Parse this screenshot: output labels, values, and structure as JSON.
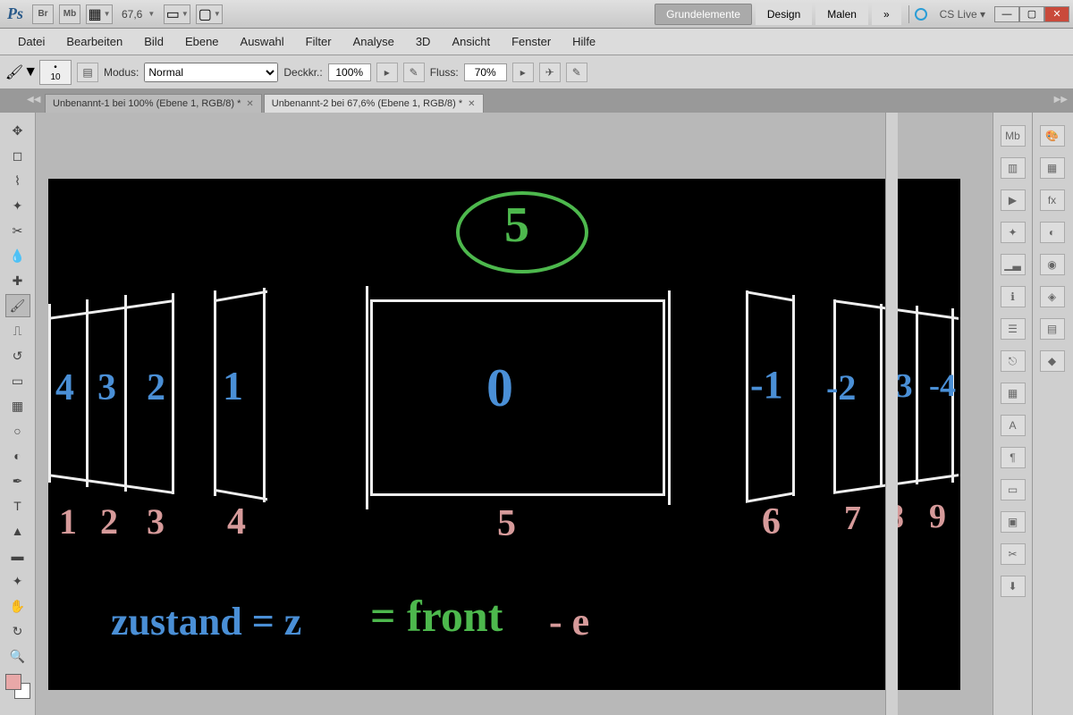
{
  "titlebar": {
    "app": "Ps",
    "br": "Br",
    "mb": "Mb",
    "zoom": "67,6",
    "workspaces": [
      "Grundelemente",
      "Design",
      "Malen"
    ],
    "active_workspace": 0,
    "more": "»",
    "cslive": "CS Live ▾"
  },
  "menu": [
    "Datei",
    "Bearbeiten",
    "Bild",
    "Ebene",
    "Auswahl",
    "Filter",
    "Analyse",
    "3D",
    "Ansicht",
    "Fenster",
    "Hilfe"
  ],
  "options": {
    "brush_size": "10",
    "modus_label": "Modus:",
    "modus_value": "Normal",
    "deckkraft_label": "Deckkr.:",
    "deckkraft_value": "100%",
    "fluss_label": "Fluss:",
    "fluss_value": "70%"
  },
  "doc_tabs": [
    "Unbenannt-1 bei 100% (Ebene 1, RGB/8) *",
    "Unbenannt-2 bei 67,6% (Ebene 1, RGB/8) *"
  ],
  "active_tab": 1,
  "canvas": {
    "circle_num": "5",
    "center_num": "0",
    "left_blue": [
      "4",
      "3",
      "2",
      "1"
    ],
    "right_blue": [
      "-1",
      "-2",
      "-3",
      "-4"
    ],
    "pink_nums": [
      "1",
      "2",
      "3",
      "4",
      "5",
      "6",
      "7",
      "8",
      "9"
    ],
    "eq1": "zustand = z",
    "eq2": "= front",
    "eq3": "- e"
  }
}
